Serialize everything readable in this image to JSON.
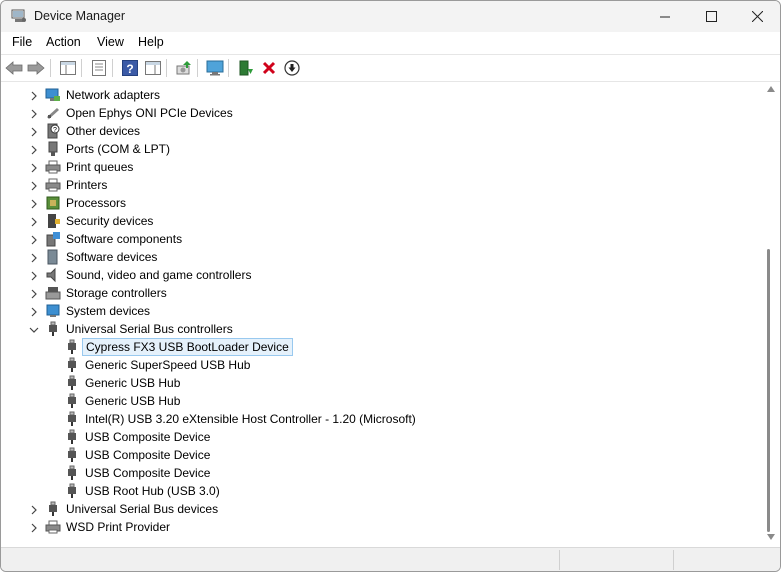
{
  "window": {
    "title": "Device Manager"
  },
  "menu": [
    {
      "label": "File"
    },
    {
      "label": "Action"
    },
    {
      "label": "View"
    },
    {
      "label": "Help"
    }
  ],
  "tree": {
    "categories_top": [
      {
        "label": "Network adapters",
        "icon": "network-adapter-icon"
      },
      {
        "label": "Open Ephys ONI PCIe Devices",
        "icon": "pcie-device-icon"
      },
      {
        "label": "Other devices",
        "icon": "unknown-device-icon"
      },
      {
        "label": "Ports (COM & LPT)",
        "icon": "port-icon"
      },
      {
        "label": "Print queues",
        "icon": "print-queue-icon"
      },
      {
        "label": "Printers",
        "icon": "printer-icon"
      },
      {
        "label": "Processors",
        "icon": "processor-icon"
      },
      {
        "label": "Security devices",
        "icon": "security-device-icon"
      },
      {
        "label": "Software components",
        "icon": "software-component-icon"
      },
      {
        "label": "Software devices",
        "icon": "software-device-icon"
      },
      {
        "label": "Sound, video and game controllers",
        "icon": "speaker-icon"
      },
      {
        "label": "Storage controllers",
        "icon": "storage-controller-icon"
      },
      {
        "label": "System devices",
        "icon": "system-device-icon"
      }
    ],
    "expanded_category": {
      "label": "Universal Serial Bus controllers",
      "icon": "usb-icon"
    },
    "usb_children": [
      {
        "label": "Cypress FX3 USB BootLoader Device",
        "selected": true
      },
      {
        "label": "Generic SuperSpeed USB Hub"
      },
      {
        "label": "Generic USB Hub"
      },
      {
        "label": "Generic USB Hub"
      },
      {
        "label": "Intel(R) USB 3.20 eXtensible Host Controller - 1.20 (Microsoft)"
      },
      {
        "label": "USB Composite Device"
      },
      {
        "label": "USB Composite Device"
      },
      {
        "label": "USB Composite Device"
      },
      {
        "label": "USB Root Hub (USB 3.0)"
      }
    ],
    "categories_bottom": [
      {
        "label": "Universal Serial Bus devices",
        "icon": "usb-icon"
      },
      {
        "label": "WSD Print Provider",
        "icon": "printer-icon"
      }
    ]
  },
  "colors": {
    "selection_bg": "#e5f1fb",
    "selection_border": "#99c9ef",
    "uninstall_red": "#d0021b",
    "help_blue": "#3b5aa6"
  }
}
